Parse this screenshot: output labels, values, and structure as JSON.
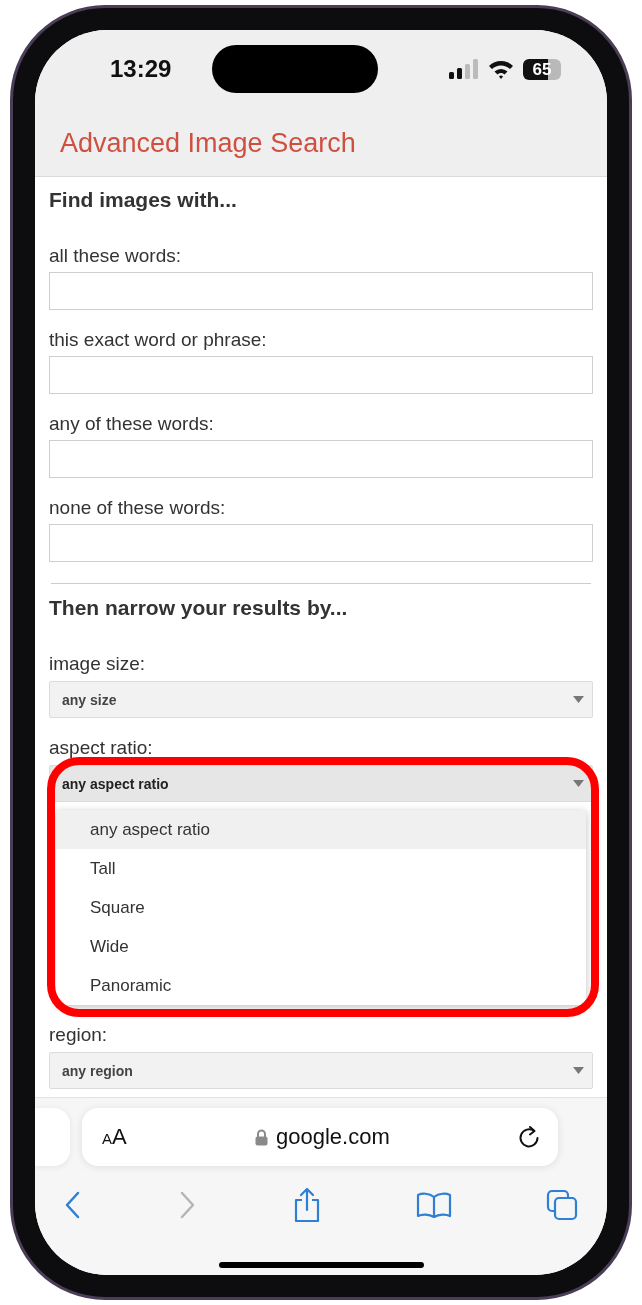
{
  "status_bar": {
    "time": "13:29",
    "battery": "65"
  },
  "page": {
    "title": "Advanced Image Search",
    "section_1": "Find images with...",
    "text_fields": [
      {
        "label": "all these words:"
      },
      {
        "label": "this exact word or phrase:"
      },
      {
        "label": "any of these words:"
      },
      {
        "label": "none of these words:"
      }
    ],
    "section_2": "Then narrow your results by...",
    "selects": [
      {
        "label": "image size:",
        "value": "any size",
        "open": false,
        "highlighted": false
      },
      {
        "label": "aspect ratio:",
        "value": "any aspect ratio",
        "open": true,
        "highlighted": true,
        "options": [
          {
            "label": "any aspect ratio",
            "selected": true
          },
          {
            "label": "Tall",
            "selected": false
          },
          {
            "label": "Square",
            "selected": false
          },
          {
            "label": "Wide",
            "selected": false
          },
          {
            "label": "Panoramic",
            "selected": false
          }
        ]
      },
      {
        "label": "region:",
        "value": "any region",
        "open": false,
        "highlighted": false
      }
    ]
  },
  "browser": {
    "text_size_button": "AA",
    "address": "google.com",
    "back_enabled": true,
    "forward_enabled": false
  }
}
